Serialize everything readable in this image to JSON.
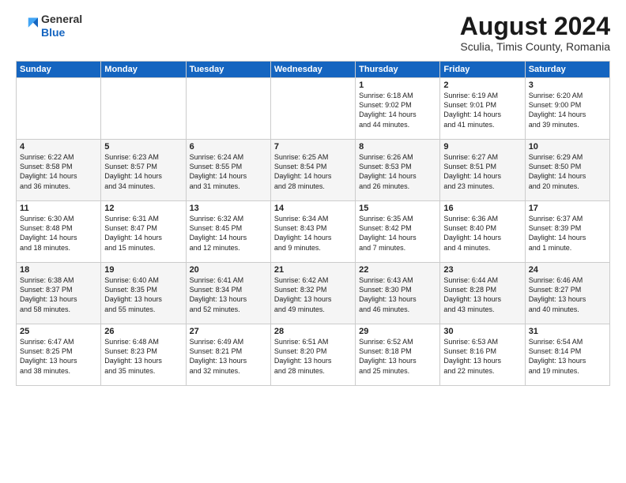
{
  "logo": {
    "general": "General",
    "blue": "Blue"
  },
  "title": "August 2024",
  "subtitle": "Sculia, Timis County, Romania",
  "headers": [
    "Sunday",
    "Monday",
    "Tuesday",
    "Wednesday",
    "Thursday",
    "Friday",
    "Saturday"
  ],
  "weeks": [
    [
      {
        "day": "",
        "info": ""
      },
      {
        "day": "",
        "info": ""
      },
      {
        "day": "",
        "info": ""
      },
      {
        "day": "",
        "info": ""
      },
      {
        "day": "1",
        "info": "Sunrise: 6:18 AM\nSunset: 9:02 PM\nDaylight: 14 hours\nand 44 minutes."
      },
      {
        "day": "2",
        "info": "Sunrise: 6:19 AM\nSunset: 9:01 PM\nDaylight: 14 hours\nand 41 minutes."
      },
      {
        "day": "3",
        "info": "Sunrise: 6:20 AM\nSunset: 9:00 PM\nDaylight: 14 hours\nand 39 minutes."
      }
    ],
    [
      {
        "day": "4",
        "info": "Sunrise: 6:22 AM\nSunset: 8:58 PM\nDaylight: 14 hours\nand 36 minutes."
      },
      {
        "day": "5",
        "info": "Sunrise: 6:23 AM\nSunset: 8:57 PM\nDaylight: 14 hours\nand 34 minutes."
      },
      {
        "day": "6",
        "info": "Sunrise: 6:24 AM\nSunset: 8:55 PM\nDaylight: 14 hours\nand 31 minutes."
      },
      {
        "day": "7",
        "info": "Sunrise: 6:25 AM\nSunset: 8:54 PM\nDaylight: 14 hours\nand 28 minutes."
      },
      {
        "day": "8",
        "info": "Sunrise: 6:26 AM\nSunset: 8:53 PM\nDaylight: 14 hours\nand 26 minutes."
      },
      {
        "day": "9",
        "info": "Sunrise: 6:27 AM\nSunset: 8:51 PM\nDaylight: 14 hours\nand 23 minutes."
      },
      {
        "day": "10",
        "info": "Sunrise: 6:29 AM\nSunset: 8:50 PM\nDaylight: 14 hours\nand 20 minutes."
      }
    ],
    [
      {
        "day": "11",
        "info": "Sunrise: 6:30 AM\nSunset: 8:48 PM\nDaylight: 14 hours\nand 18 minutes."
      },
      {
        "day": "12",
        "info": "Sunrise: 6:31 AM\nSunset: 8:47 PM\nDaylight: 14 hours\nand 15 minutes."
      },
      {
        "day": "13",
        "info": "Sunrise: 6:32 AM\nSunset: 8:45 PM\nDaylight: 14 hours\nand 12 minutes."
      },
      {
        "day": "14",
        "info": "Sunrise: 6:34 AM\nSunset: 8:43 PM\nDaylight: 14 hours\nand 9 minutes."
      },
      {
        "day": "15",
        "info": "Sunrise: 6:35 AM\nSunset: 8:42 PM\nDaylight: 14 hours\nand 7 minutes."
      },
      {
        "day": "16",
        "info": "Sunrise: 6:36 AM\nSunset: 8:40 PM\nDaylight: 14 hours\nand 4 minutes."
      },
      {
        "day": "17",
        "info": "Sunrise: 6:37 AM\nSunset: 8:39 PM\nDaylight: 14 hours\nand 1 minute."
      }
    ],
    [
      {
        "day": "18",
        "info": "Sunrise: 6:38 AM\nSunset: 8:37 PM\nDaylight: 13 hours\nand 58 minutes."
      },
      {
        "day": "19",
        "info": "Sunrise: 6:40 AM\nSunset: 8:35 PM\nDaylight: 13 hours\nand 55 minutes."
      },
      {
        "day": "20",
        "info": "Sunrise: 6:41 AM\nSunset: 8:34 PM\nDaylight: 13 hours\nand 52 minutes."
      },
      {
        "day": "21",
        "info": "Sunrise: 6:42 AM\nSunset: 8:32 PM\nDaylight: 13 hours\nand 49 minutes."
      },
      {
        "day": "22",
        "info": "Sunrise: 6:43 AM\nSunset: 8:30 PM\nDaylight: 13 hours\nand 46 minutes."
      },
      {
        "day": "23",
        "info": "Sunrise: 6:44 AM\nSunset: 8:28 PM\nDaylight: 13 hours\nand 43 minutes."
      },
      {
        "day": "24",
        "info": "Sunrise: 6:46 AM\nSunset: 8:27 PM\nDaylight: 13 hours\nand 40 minutes."
      }
    ],
    [
      {
        "day": "25",
        "info": "Sunrise: 6:47 AM\nSunset: 8:25 PM\nDaylight: 13 hours\nand 38 minutes."
      },
      {
        "day": "26",
        "info": "Sunrise: 6:48 AM\nSunset: 8:23 PM\nDaylight: 13 hours\nand 35 minutes."
      },
      {
        "day": "27",
        "info": "Sunrise: 6:49 AM\nSunset: 8:21 PM\nDaylight: 13 hours\nand 32 minutes."
      },
      {
        "day": "28",
        "info": "Sunrise: 6:51 AM\nSunset: 8:20 PM\nDaylight: 13 hours\nand 28 minutes."
      },
      {
        "day": "29",
        "info": "Sunrise: 6:52 AM\nSunset: 8:18 PM\nDaylight: 13 hours\nand 25 minutes."
      },
      {
        "day": "30",
        "info": "Sunrise: 6:53 AM\nSunset: 8:16 PM\nDaylight: 13 hours\nand 22 minutes."
      },
      {
        "day": "31",
        "info": "Sunrise: 6:54 AM\nSunset: 8:14 PM\nDaylight: 13 hours\nand 19 minutes."
      }
    ]
  ]
}
